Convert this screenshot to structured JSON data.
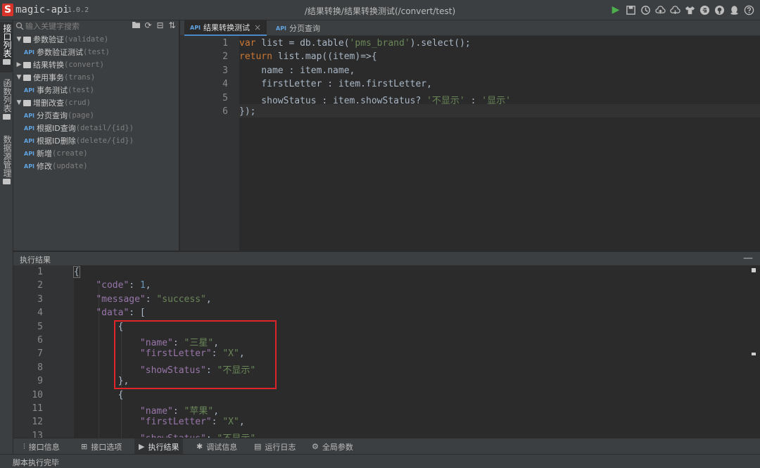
{
  "app": {
    "name": "magic-api",
    "version": "1.0.2",
    "title_path": "/结果转换/结果转换测试(/convert/test)"
  },
  "toolbar_icons": [
    "run-icon",
    "save-icon",
    "history-icon",
    "upload-icon",
    "download-icon",
    "skin-icon",
    "gitee-icon",
    "github-icon",
    "qq-icon",
    "help-icon"
  ],
  "vertical_tabs": [
    {
      "label": "接口列表",
      "active": true
    },
    {
      "label": "函数列表",
      "active": false
    },
    {
      "label": "数据源管理",
      "active": false
    }
  ],
  "sidebar": {
    "search_placeholder": "输入关键字搜索",
    "tools": [
      "folder-add-icon",
      "refresh-icon",
      "collapse-icon",
      "sort-icon"
    ],
    "tree": [
      {
        "type": "group",
        "expanded": true,
        "name": "参数验证",
        "path": "(validate)"
      },
      {
        "type": "leaf",
        "name": "参数验证测试",
        "path": "(test)"
      },
      {
        "type": "group",
        "expanded": false,
        "name": "结果转换",
        "path": "(convert)"
      },
      {
        "type": "group",
        "expanded": true,
        "name": "使用事务",
        "path": "(trans)"
      },
      {
        "type": "leaf",
        "name": "事务测试",
        "path": "(test)"
      },
      {
        "type": "group",
        "expanded": true,
        "name": "增删改查",
        "path": "(crud)"
      },
      {
        "type": "leaf",
        "name": "分页查询",
        "path": "(page)"
      },
      {
        "type": "leaf",
        "name": "根据ID查询",
        "path": "(detail/{id})"
      },
      {
        "type": "leaf",
        "name": "根据ID删除",
        "path": "(delete/{id})"
      },
      {
        "type": "leaf",
        "name": "新增",
        "path": "(create)"
      },
      {
        "type": "leaf",
        "name": "修改",
        "path": "(update)"
      }
    ],
    "api_tag": "API"
  },
  "editor": {
    "tabs": [
      {
        "label": "结果转换测试",
        "active": true
      },
      {
        "label": "分页查询",
        "active": false
      }
    ],
    "line_numbers": [
      "1",
      "2",
      "3",
      "4",
      "5",
      "6"
    ],
    "lines": [
      [
        {
          "t": "var",
          "c": "kw"
        },
        {
          "t": " list = db.table(",
          "c": "cn"
        },
        {
          "t": "'pms_brand'",
          "c": "str"
        },
        {
          "t": ").select();",
          "c": "cn"
        }
      ],
      [
        {
          "t": "return",
          "c": "kw"
        },
        {
          "t": " list.map((item)=>{",
          "c": "cn"
        }
      ],
      [
        {
          "t": "    name : item.name,",
          "c": "cn"
        }
      ],
      [
        {
          "t": "    firstLetter : item.firstLetter,",
          "c": "cn"
        }
      ],
      [
        {
          "t": "    showStatus : item.showStatus? ",
          "c": "cn"
        },
        {
          "t": "'不显示'",
          "c": "str"
        },
        {
          "t": " : ",
          "c": "cn"
        },
        {
          "t": "'显示'",
          "c": "str"
        }
      ],
      [
        {
          "t": "});",
          "c": "cn"
        }
      ]
    ]
  },
  "result": {
    "title": "执行结果",
    "minimize": "—",
    "line_numbers": [
      "1",
      "2",
      "3",
      "4",
      "5",
      "6",
      "7",
      "8",
      "9",
      "10",
      "11",
      "12",
      "13"
    ],
    "lines": [
      [
        {
          "t": "{",
          "c": "p"
        }
      ],
      [
        {
          "t": "    ",
          "c": "p"
        },
        {
          "t": "\"code\"",
          "c": "k"
        },
        {
          "t": ": ",
          "c": "p"
        },
        {
          "t": "1",
          "c": "n"
        },
        {
          "t": ",",
          "c": "p"
        }
      ],
      [
        {
          "t": "    ",
          "c": "p"
        },
        {
          "t": "\"message\"",
          "c": "k"
        },
        {
          "t": ": ",
          "c": "p"
        },
        {
          "t": "\"success\"",
          "c": "s"
        },
        {
          "t": ",",
          "c": "p"
        }
      ],
      [
        {
          "t": "    ",
          "c": "p"
        },
        {
          "t": "\"data\"",
          "c": "k"
        },
        {
          "t": ": [",
          "c": "p"
        }
      ],
      [
        {
          "t": "        {",
          "c": "p"
        }
      ],
      [
        {
          "t": "            ",
          "c": "p"
        },
        {
          "t": "\"name\"",
          "c": "k"
        },
        {
          "t": ": ",
          "c": "p"
        },
        {
          "t": "\"三星\"",
          "c": "s"
        },
        {
          "t": ",",
          "c": "p"
        }
      ],
      [
        {
          "t": "            ",
          "c": "p"
        },
        {
          "t": "\"firstLetter\"",
          "c": "k"
        },
        {
          "t": ": ",
          "c": "p"
        },
        {
          "t": "\"X\"",
          "c": "s"
        },
        {
          "t": ",",
          "c": "p"
        }
      ],
      [
        {
          "t": "            ",
          "c": "p"
        },
        {
          "t": "\"showStatus\"",
          "c": "k"
        },
        {
          "t": ": ",
          "c": "p"
        },
        {
          "t": "\"不显示\"",
          "c": "s"
        }
      ],
      [
        {
          "t": "        },",
          "c": "p"
        }
      ],
      [
        {
          "t": "        {",
          "c": "p"
        }
      ],
      [
        {
          "t": "            ",
          "c": "p"
        },
        {
          "t": "\"name\"",
          "c": "k"
        },
        {
          "t": ": ",
          "c": "p"
        },
        {
          "t": "\"苹果\"",
          "c": "s"
        },
        {
          "t": ",",
          "c": "p"
        }
      ],
      [
        {
          "t": "            ",
          "c": "p"
        },
        {
          "t": "\"firstLetter\"",
          "c": "k"
        },
        {
          "t": ": ",
          "c": "p"
        },
        {
          "t": "\"X\"",
          "c": "s"
        },
        {
          "t": ",",
          "c": "p"
        }
      ],
      [
        {
          "t": "            ",
          "c": "p"
        },
        {
          "t": "\"showStatus\"",
          "c": "k"
        },
        {
          "t": ": ",
          "c": "p"
        },
        {
          "t": "\"不显示\"",
          "c": "s"
        }
      ]
    ]
  },
  "bottom_tabs": [
    {
      "label": "接口信息",
      "icon": "sliders-icon",
      "active": false
    },
    {
      "label": "接口选项",
      "icon": "grid-icon",
      "active": false
    },
    {
      "label": "执行结果",
      "icon": "play-icon",
      "active": true
    },
    {
      "label": "调试信息",
      "icon": "bug-icon",
      "active": false
    },
    {
      "label": "运行日志",
      "icon": "log-icon",
      "active": false
    },
    {
      "label": "全局参数",
      "icon": "gear-icon",
      "active": false
    }
  ],
  "status": "脚本执行完毕",
  "colors": {
    "background": "#2b2b2b",
    "panel": "#3c3f41",
    "keyword": "#cc7832",
    "string": "#6a8759",
    "json_key": "#9876aa",
    "number": "#6897bb",
    "highlight_box": "#e0242a"
  }
}
